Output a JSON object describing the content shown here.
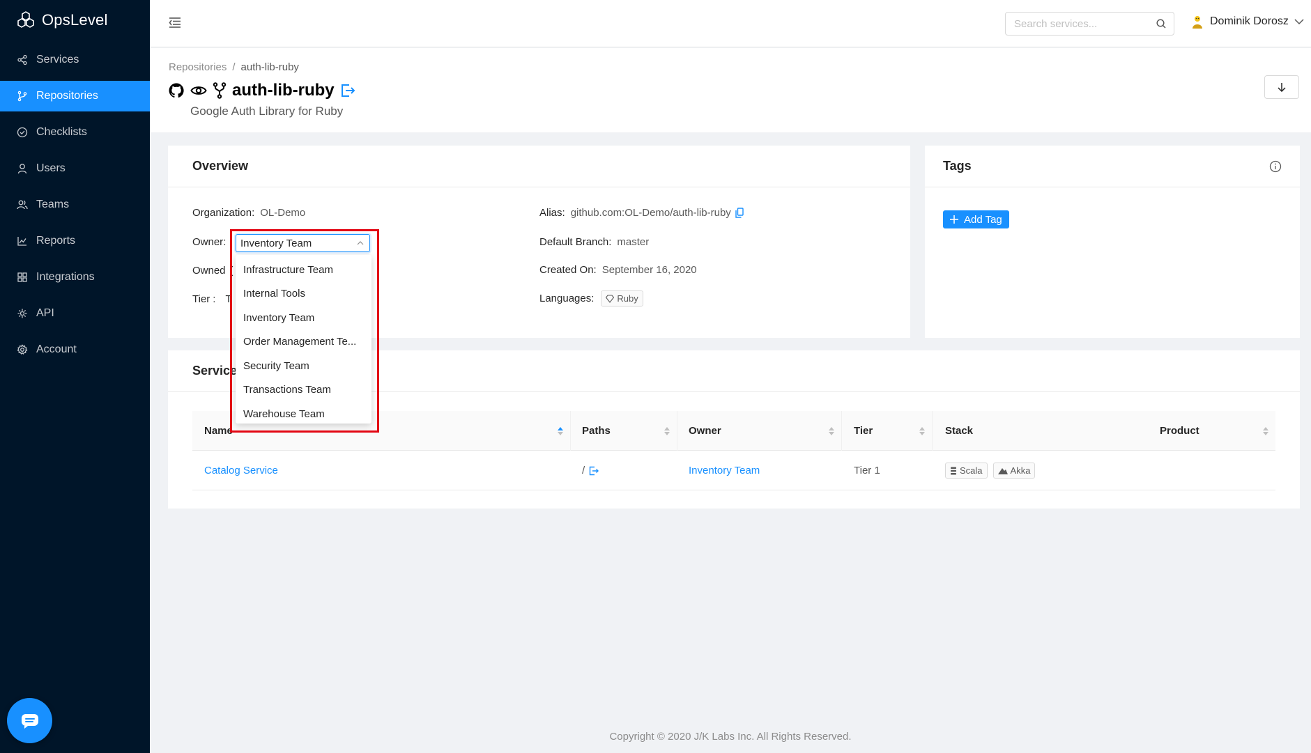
{
  "app": {
    "name": "OpsLevel"
  },
  "sidebar": {
    "items": [
      {
        "label": "Services",
        "icon": "share-icon"
      },
      {
        "label": "Repositories",
        "icon": "branch-icon",
        "active": true
      },
      {
        "label": "Checklists",
        "icon": "check-circle-icon"
      },
      {
        "label": "Users",
        "icon": "user-icon"
      },
      {
        "label": "Teams",
        "icon": "team-icon"
      },
      {
        "label": "Reports",
        "icon": "chart-icon"
      },
      {
        "label": "Integrations",
        "icon": "grid-icon"
      },
      {
        "label": "API",
        "icon": "api-icon"
      },
      {
        "label": "Account",
        "icon": "gear-icon"
      }
    ]
  },
  "header": {
    "search_placeholder": "Search services...",
    "user_name": "Dominik Dorosz"
  },
  "breadcrumb": {
    "root": "Repositories",
    "separator": "/",
    "current": "auth-lib-ruby"
  },
  "page": {
    "title": "auth-lib-ruby",
    "subtitle": "Google Auth Library for Ruby"
  },
  "overview": {
    "heading": "Overview",
    "organization_label": "Organization",
    "organization_value": "OL-Demo",
    "owner_label": "Owner",
    "owner_selected": "Inventory Team",
    "owned_label": "Owned",
    "owned_partial": "(",
    "tier_label": "Tier",
    "tier_partial": "T",
    "alias_label": "Alias",
    "alias_value": "github.com:OL-Demo/auth-lib-ruby",
    "branch_label": "Default Branch",
    "branch_value": "master",
    "created_label": "Created On",
    "created_value": "September 16, 2020",
    "languages_label": "Languages",
    "language": "Ruby",
    "colon": ":"
  },
  "owner_dropdown": {
    "options": [
      "Infrastructure Team",
      "Internal Tools",
      "Inventory Team",
      "Order Management Te...",
      "Security Team",
      "Transactions Team",
      "Warehouse Team"
    ]
  },
  "tags": {
    "heading": "Tags",
    "add_label": "Add Tag"
  },
  "services": {
    "heading": "Services",
    "columns": [
      "Name",
      "Paths",
      "Owner",
      "Tier",
      "Stack",
      "Product"
    ],
    "rows": [
      {
        "name": "Catalog Service",
        "path": "/",
        "owner": "Inventory Team",
        "tier": "Tier 1",
        "stack": [
          "Scala",
          "Akka"
        ]
      }
    ]
  },
  "footer": {
    "text": "Copyright © 2020 J/K Labs Inc. All Rights Reserved."
  },
  "colors": {
    "sidebar": "#001529",
    "accent": "#1890ff",
    "highlight": "#e30613"
  }
}
